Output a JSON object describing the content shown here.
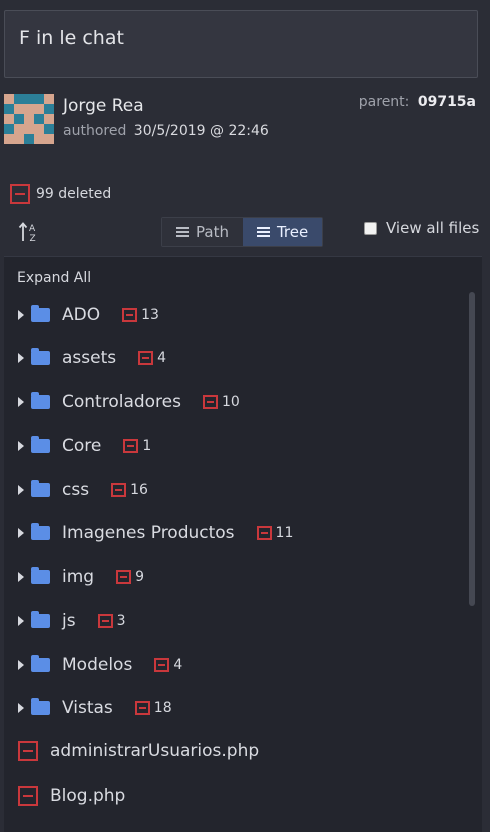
{
  "commit": {
    "message": "F in le chat",
    "author_name": "Jorge Rea",
    "authored_label": "authored",
    "authored_date": "30/5/2019 @ 22:46",
    "parent_label": "parent:",
    "parent_sha": "09715a"
  },
  "summary": {
    "deleted": "99 deleted"
  },
  "toolbar": {
    "path_label": "Path",
    "tree_label": "Tree",
    "view_all_label": "View all files",
    "view_all_checked": false,
    "sort_glyph": "A Z"
  },
  "tree": {
    "expand_all": "Expand All",
    "folders": [
      {
        "name": "ADO",
        "deleted": "13"
      },
      {
        "name": "assets",
        "deleted": "4"
      },
      {
        "name": "Controladores",
        "deleted": "10"
      },
      {
        "name": "Core",
        "deleted": "1"
      },
      {
        "name": "css",
        "deleted": "16"
      },
      {
        "name": "Imagenes Productos",
        "deleted": "11"
      },
      {
        "name": "img",
        "deleted": "9"
      },
      {
        "name": "js",
        "deleted": "3"
      },
      {
        "name": "Modelos",
        "deleted": "4"
      },
      {
        "name": "Vistas",
        "deleted": "18"
      }
    ],
    "files": [
      {
        "name": "administrarUsuarios.php"
      },
      {
        "name": "Blog.php"
      }
    ]
  },
  "colors": {
    "deleted": "#c9383c",
    "folder": "#5b8ee6",
    "active_tab": "#3a4a6b"
  }
}
